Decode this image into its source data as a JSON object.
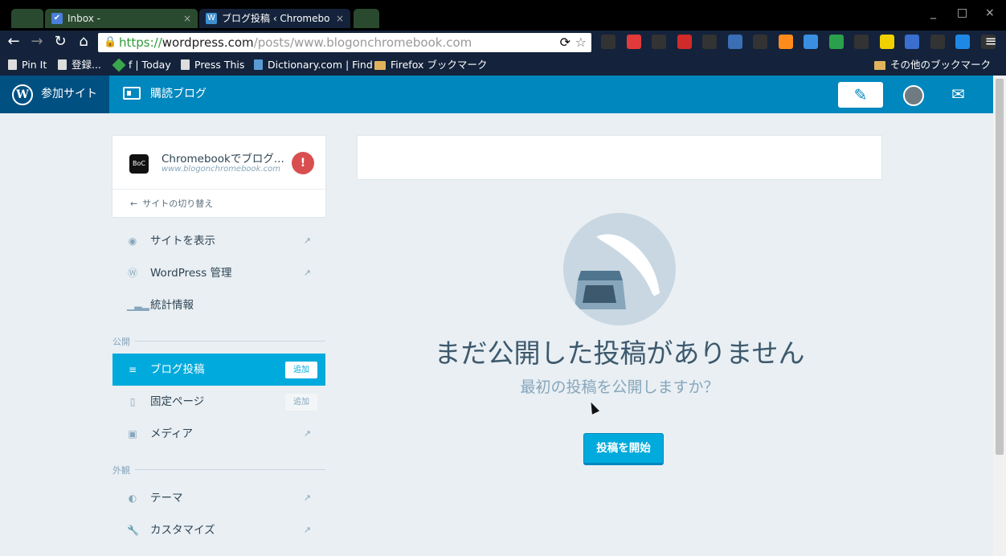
{
  "browser": {
    "tabs": [
      {
        "title": "",
        "active": false
      },
      {
        "title": "Inbox - ",
        "active": false
      },
      {
        "title": "ブログ投稿 ‹ Chromebo",
        "active": true
      },
      {
        "title": "",
        "active": false
      }
    ],
    "close_glyph": "×",
    "window_controls": [
      "_",
      "□",
      "×"
    ],
    "url": {
      "scheme": "https://",
      "host": "wordpress.com",
      "path": "/posts/www.blogonchromebook.com"
    },
    "bookmarks": [
      {
        "label": "Pin It",
        "icon": "page-icon"
      },
      {
        "label": "登録...",
        "icon": "page-icon"
      },
      {
        "label": "f | Today",
        "icon": "feedly-icon"
      },
      {
        "label": "Press This",
        "icon": "page-icon"
      },
      {
        "label": "Dictionary.com | Find",
        "icon": "dictionary-icon"
      },
      {
        "label": "Firefox ブックマーク",
        "icon": "folder-icon"
      }
    ],
    "other_bookmarks": "その他のブックマーク",
    "extension_colors": [
      "#333",
      "#e23a3a",
      "#333",
      "#d12a2a",
      "#333",
      "#3a6fb5",
      "#333",
      "#ff8c1a",
      "#3a8fe0",
      "#2aa04c",
      "#333",
      "#f0d000",
      "#3a6fd0",
      "#333",
      "#1e88e5",
      "#333"
    ]
  },
  "masterbar": {
    "my_sites": "参加サイト",
    "reader": "購読ブログ",
    "write_icon": "write-post-icon",
    "notifications_icon": "notifications-icon"
  },
  "sidebar": {
    "site": {
      "title": "Chromebookでブログ...",
      "url": "www.blogonchromebook.com",
      "icon_text": "BoC"
    },
    "switch_label": "サイトの切り替え",
    "items_top": [
      {
        "label": "サイトを表示",
        "icon": "globe-icon",
        "external": true
      },
      {
        "label": "WordPress 管理",
        "icon": "wordpress-icon",
        "external": true
      },
      {
        "label": "統計情報",
        "icon": "stats-icon",
        "external": false
      }
    ],
    "publish_section": "公開",
    "items_publish": [
      {
        "label": "ブログ投稿",
        "icon": "posts-icon",
        "add": "追加",
        "selected": true
      },
      {
        "label": "固定ページ",
        "icon": "pages-icon",
        "add": "追加",
        "selected": false
      },
      {
        "label": "メディア",
        "icon": "media-icon",
        "external": true,
        "selected": false
      }
    ],
    "design_section": "外観",
    "items_design": [
      {
        "label": "テーマ",
        "icon": "themes-icon",
        "external": true
      },
      {
        "label": "カスタマイズ",
        "icon": "customize-icon",
        "external": true
      }
    ]
  },
  "main": {
    "empty_title": "まだ公開した投稿がありません",
    "empty_subtitle": "最初の投稿を公開しますか？",
    "start_button": "投稿を開始"
  }
}
